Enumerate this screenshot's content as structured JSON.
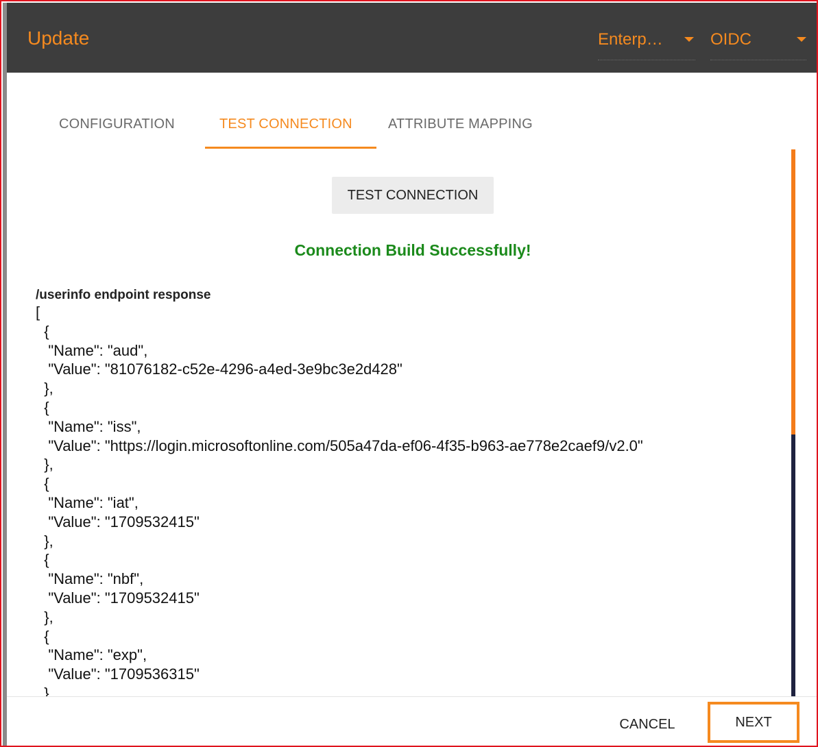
{
  "header": {
    "title": "Update",
    "enterprise_select": {
      "value": "Enterp…",
      "icon": "caret-down-icon"
    },
    "protocol_select": {
      "value": "OIDC",
      "icon": "caret-down-icon"
    }
  },
  "tabs": [
    {
      "label": "CONFIGURATION",
      "active": false
    },
    {
      "label": "TEST CONNECTION",
      "active": true
    },
    {
      "label": "ATTRIBUTE MAPPING",
      "active": false
    }
  ],
  "test_connection": {
    "button_label": "TEST CONNECTION",
    "success_message": "Connection Build Successfully!",
    "response_title": "/userinfo endpoint response",
    "response_lines": [
      "[",
      "  {",
      "   \"Name\": \"aud\",",
      "   \"Value\": \"81076182-c52e-4296-a4ed-3e9bc3e2d428\"",
      "  },",
      "  {",
      "   \"Name\": \"iss\",",
      "   \"Value\": \"https://login.microsoftonline.com/505a47da-ef06-4f35-b963-ae778e2caef9/v2.0\"",
      "  },",
      "  {",
      "   \"Name\": \"iat\",",
      "   \"Value\": \"1709532415\"",
      "  },",
      "  {",
      "   \"Name\": \"nbf\",",
      "   \"Value\": \"1709532415\"",
      "  },",
      "  {",
      "   \"Name\": \"exp\",",
      "   \"Value\": \"1709536315\"",
      "  },"
    ]
  },
  "footer": {
    "cancel_label": "CANCEL",
    "next_label": "NEXT"
  },
  "colors": {
    "accent": "#f58a1f",
    "header_bg": "#3d3d3d",
    "success": "#1b8a1b",
    "frame_highlight": "#e0141e",
    "scroll_track": "#1f2340"
  }
}
